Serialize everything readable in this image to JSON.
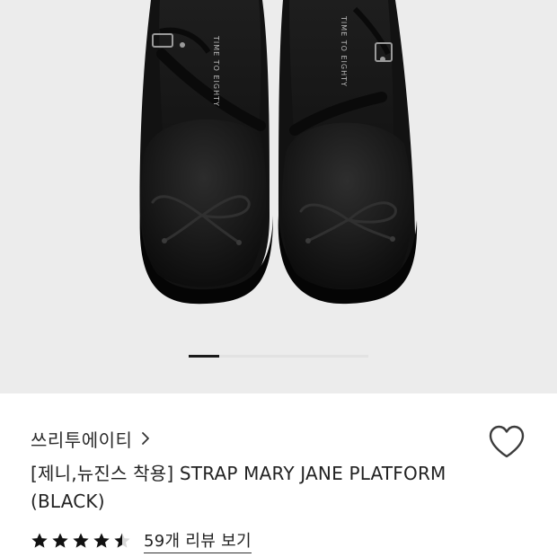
{
  "product_image": {
    "description_icon": "black-platform-mary-jane-shoes-photo",
    "insole_print": "TIME TO EIGHTY",
    "pager": {
      "current": 1,
      "total": 6
    }
  },
  "brand": {
    "name": "쓰리투에이티",
    "chevron_icon": "chevron-right-icon"
  },
  "wishlist": {
    "icon": "heart-outline-icon"
  },
  "product": {
    "title": "[제니,뉴진스 착용] STRAP MARY JANE PLATFORM (BLACK)"
  },
  "rating": {
    "value": 4.5,
    "max": 5,
    "review_link": "59개 리뷰 보기"
  },
  "colors": {
    "gallery_bg": "#ececec",
    "star": "#111111",
    "pager_active": "#1a1a1a"
  }
}
